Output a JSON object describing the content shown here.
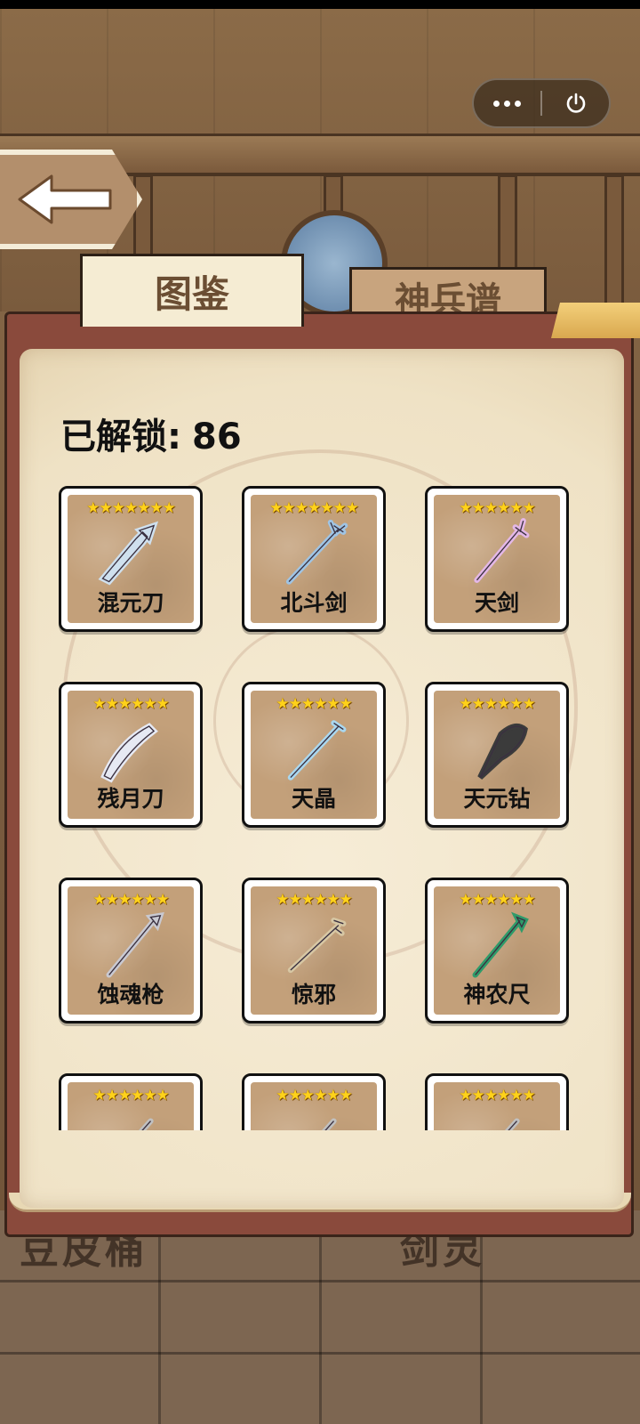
{
  "capsule": {
    "more_icon": "more-dots-icon",
    "power_icon": "power-icon"
  },
  "back_icon": "back-arrow-icon",
  "tabs": [
    {
      "label": "图鉴",
      "active": true
    },
    {
      "label": "神兵谱",
      "active": false
    }
  ],
  "unlocked": {
    "label": "已解锁:",
    "count": "86"
  },
  "background_text": {
    "left": "豆皮桶",
    "right": "剑灵"
  },
  "star_color": "#ffd21a",
  "items": [
    {
      "name": "混元刀",
      "stars": "★★★★★★★",
      "weapon_color": "#cfe0ee"
    },
    {
      "name": "北斗剑",
      "stars": "★★★★★★★",
      "weapon_color": "#9fc4e4"
    },
    {
      "name": "天剑",
      "stars": "★★★★★★",
      "weapon_color": "#e3b7e6"
    },
    {
      "name": "残月刀",
      "stars": "★★★★★★",
      "weapon_color": "#e6e9f3"
    },
    {
      "name": "天晶",
      "stars": "★★★★★★",
      "weapon_color": "#a9d7ef"
    },
    {
      "name": "天元钻",
      "stars": "★★★★★★",
      "weapon_color": "#3b3b3b"
    },
    {
      "name": "蚀魂枪",
      "stars": "★★★★★★",
      "weapon_color": "#c9c9d1"
    },
    {
      "name": "惊邪",
      "stars": "★★★★★★",
      "weapon_color": "#d7c7a4"
    },
    {
      "name": "神农尺",
      "stars": "★★★★★★",
      "weapon_color": "#2f9b6a"
    },
    {
      "name": "",
      "stars": "★★★★★★",
      "weapon_color": "#c0c0c0"
    },
    {
      "name": "",
      "stars": "★★★★★★",
      "weapon_color": "#c0c0c0"
    },
    {
      "name": "",
      "stars": "★★★★★★",
      "weapon_color": "#c0c0c0"
    }
  ]
}
